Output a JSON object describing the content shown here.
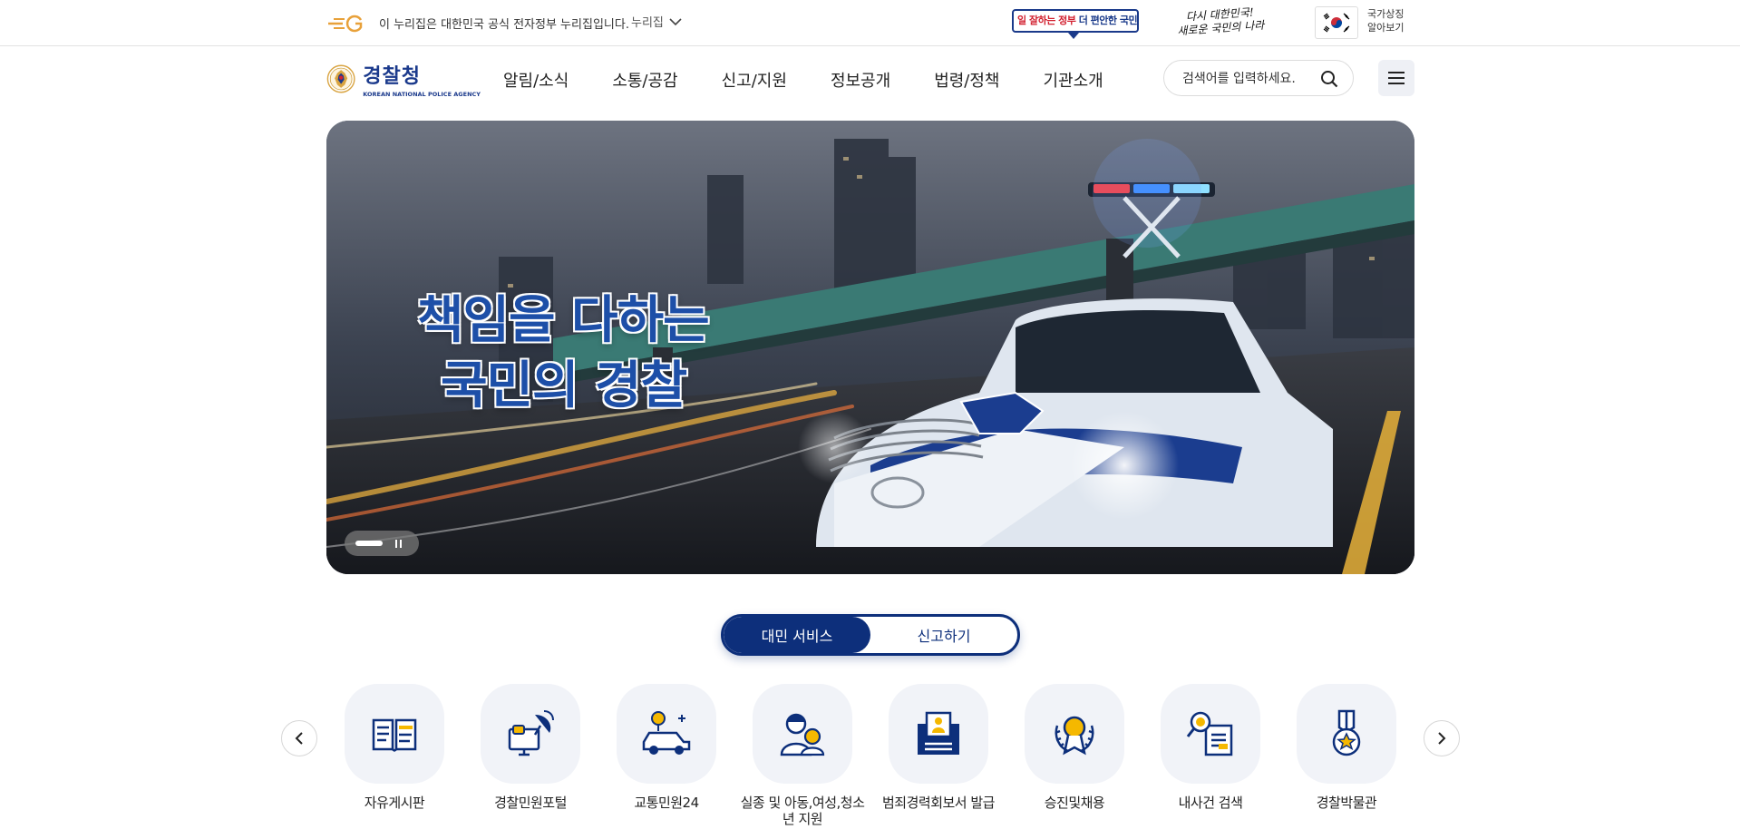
{
  "gov_strip": {
    "eg_logo": "eG",
    "notice": "이 누리집은 대한민국 공식 전자정부 누리집입니다.",
    "nuri_toggle": "누리집",
    "slogan_badge": {
      "red": "일 잘하는 정부",
      "blue": "더 편안한 국민"
    },
    "script_slogan_line1": "다시 대한민국!",
    "script_slogan_line2": "새로운 국민의 나라",
    "state_symbol_line1": "국가상징",
    "state_symbol_line2": "알아보기"
  },
  "header": {
    "logo_kr": "경찰청",
    "logo_en": "KOREAN NATIONAL POLICE AGENCY",
    "nav": [
      "알림/소식",
      "소통/공감",
      "신고/지원",
      "정보공개",
      "법령/정책",
      "기관소개"
    ],
    "search_placeholder": "검색어를 입력하세요."
  },
  "hero": {
    "title_line1": "책임을 다하는",
    "title_line2": "국민의 경찰"
  },
  "tabs": {
    "active": "대민 서비스",
    "inactive": "신고하기"
  },
  "services": [
    {
      "label": "자유게시판",
      "icon": "board-book-icon"
    },
    {
      "label": "경찰민원포털",
      "icon": "satellite-monitor-icon"
    },
    {
      "label": "교통민원24",
      "icon": "traffic-car-icon"
    },
    {
      "label": "실종 및 아동,여성,청소년 지원",
      "icon": "family-icon"
    },
    {
      "label": "범죄경력회보서 발급",
      "icon": "id-document-icon"
    },
    {
      "label": "승진및채용",
      "icon": "medal-laurel-icon"
    },
    {
      "label": "내사건 검색",
      "icon": "case-search-icon"
    },
    {
      "label": "경찰박물관",
      "icon": "museum-medal-icon"
    }
  ],
  "colors": {
    "primary": "#0d2f7b",
    "brand_blue": "#1b3a8c",
    "icon_bg": "#f1f3f8",
    "accent_yellow": "#f5b800"
  }
}
